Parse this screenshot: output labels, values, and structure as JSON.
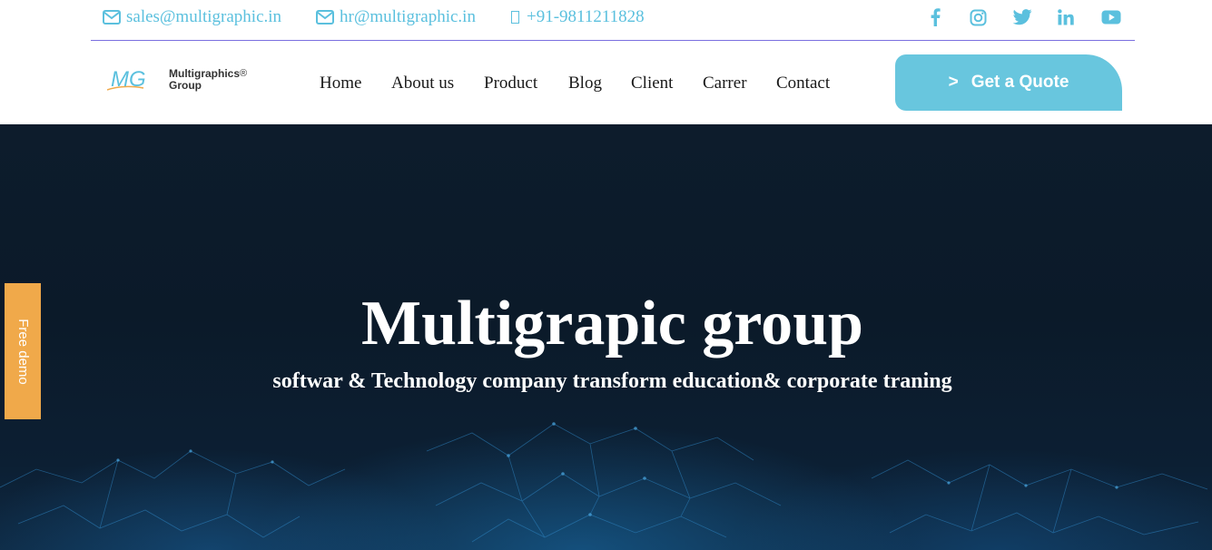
{
  "topbar": {
    "email_sales": "sales@multigraphic.in",
    "email_hr": "hr@multigraphic.in",
    "phone": "+91-9811211828",
    "social_icons": [
      "facebook-icon",
      "instagram-icon",
      "twitter-icon",
      "linkedin-icon",
      "youtube-icon"
    ]
  },
  "logo": {
    "mark": "MG",
    "name": "Multigraphics",
    "reg": "®",
    "sub": "Group"
  },
  "nav": {
    "items": [
      "Home",
      "About us",
      "Product",
      "Blog",
      "Client",
      "Carrer",
      "Contact"
    ]
  },
  "cta": {
    "arrow": ">",
    "label": "Get a Quote"
  },
  "hero": {
    "title": "Multigrapic group",
    "subtitle": "softwar & Technology company transform education& corporate traning"
  },
  "side_tab": {
    "label": "Free demo"
  },
  "colors": {
    "accent": "#5bc0de",
    "button": "#68c6de",
    "divider": "#7b6fe0",
    "side_tab": "#f0a94a",
    "hero_bg": "#0b1a29"
  }
}
